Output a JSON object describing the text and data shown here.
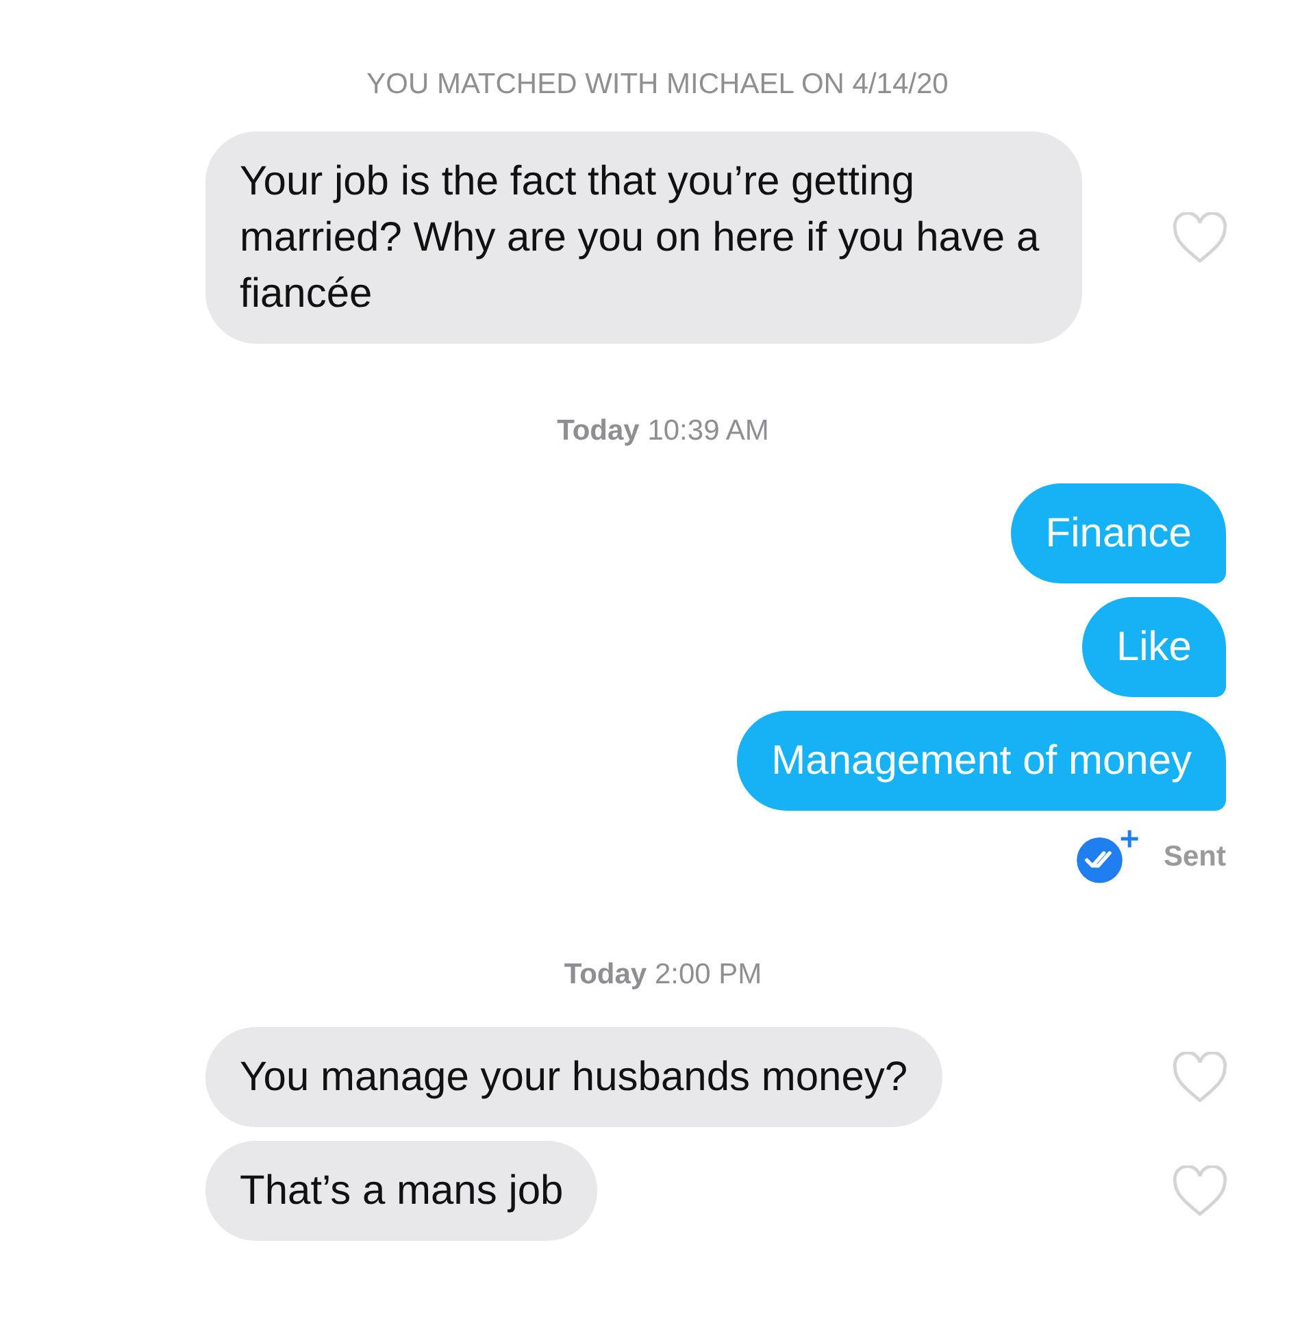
{
  "match_notice": "YOU MATCHED WITH MICHAEL ON 4/14/20",
  "items": [
    {
      "kind": "incoming",
      "text": "Your job is the fact that you’re getting married? Why are you on here if you have a fiancée",
      "liked": false
    },
    {
      "kind": "timestamp",
      "day": "Today",
      "time": "10:39 AM"
    },
    {
      "kind": "outgoing",
      "text": "Finance"
    },
    {
      "kind": "outgoing",
      "text": "Like"
    },
    {
      "kind": "outgoing",
      "text": "Management of money"
    },
    {
      "kind": "status",
      "text": "Sent",
      "read": true
    },
    {
      "kind": "timestamp",
      "day": "Today",
      "time": "2:00 PM"
    },
    {
      "kind": "incoming",
      "text": "You manage your husbands money?",
      "liked": false
    },
    {
      "kind": "incoming",
      "text": "That’s a mans job",
      "liked": false
    }
  ]
}
